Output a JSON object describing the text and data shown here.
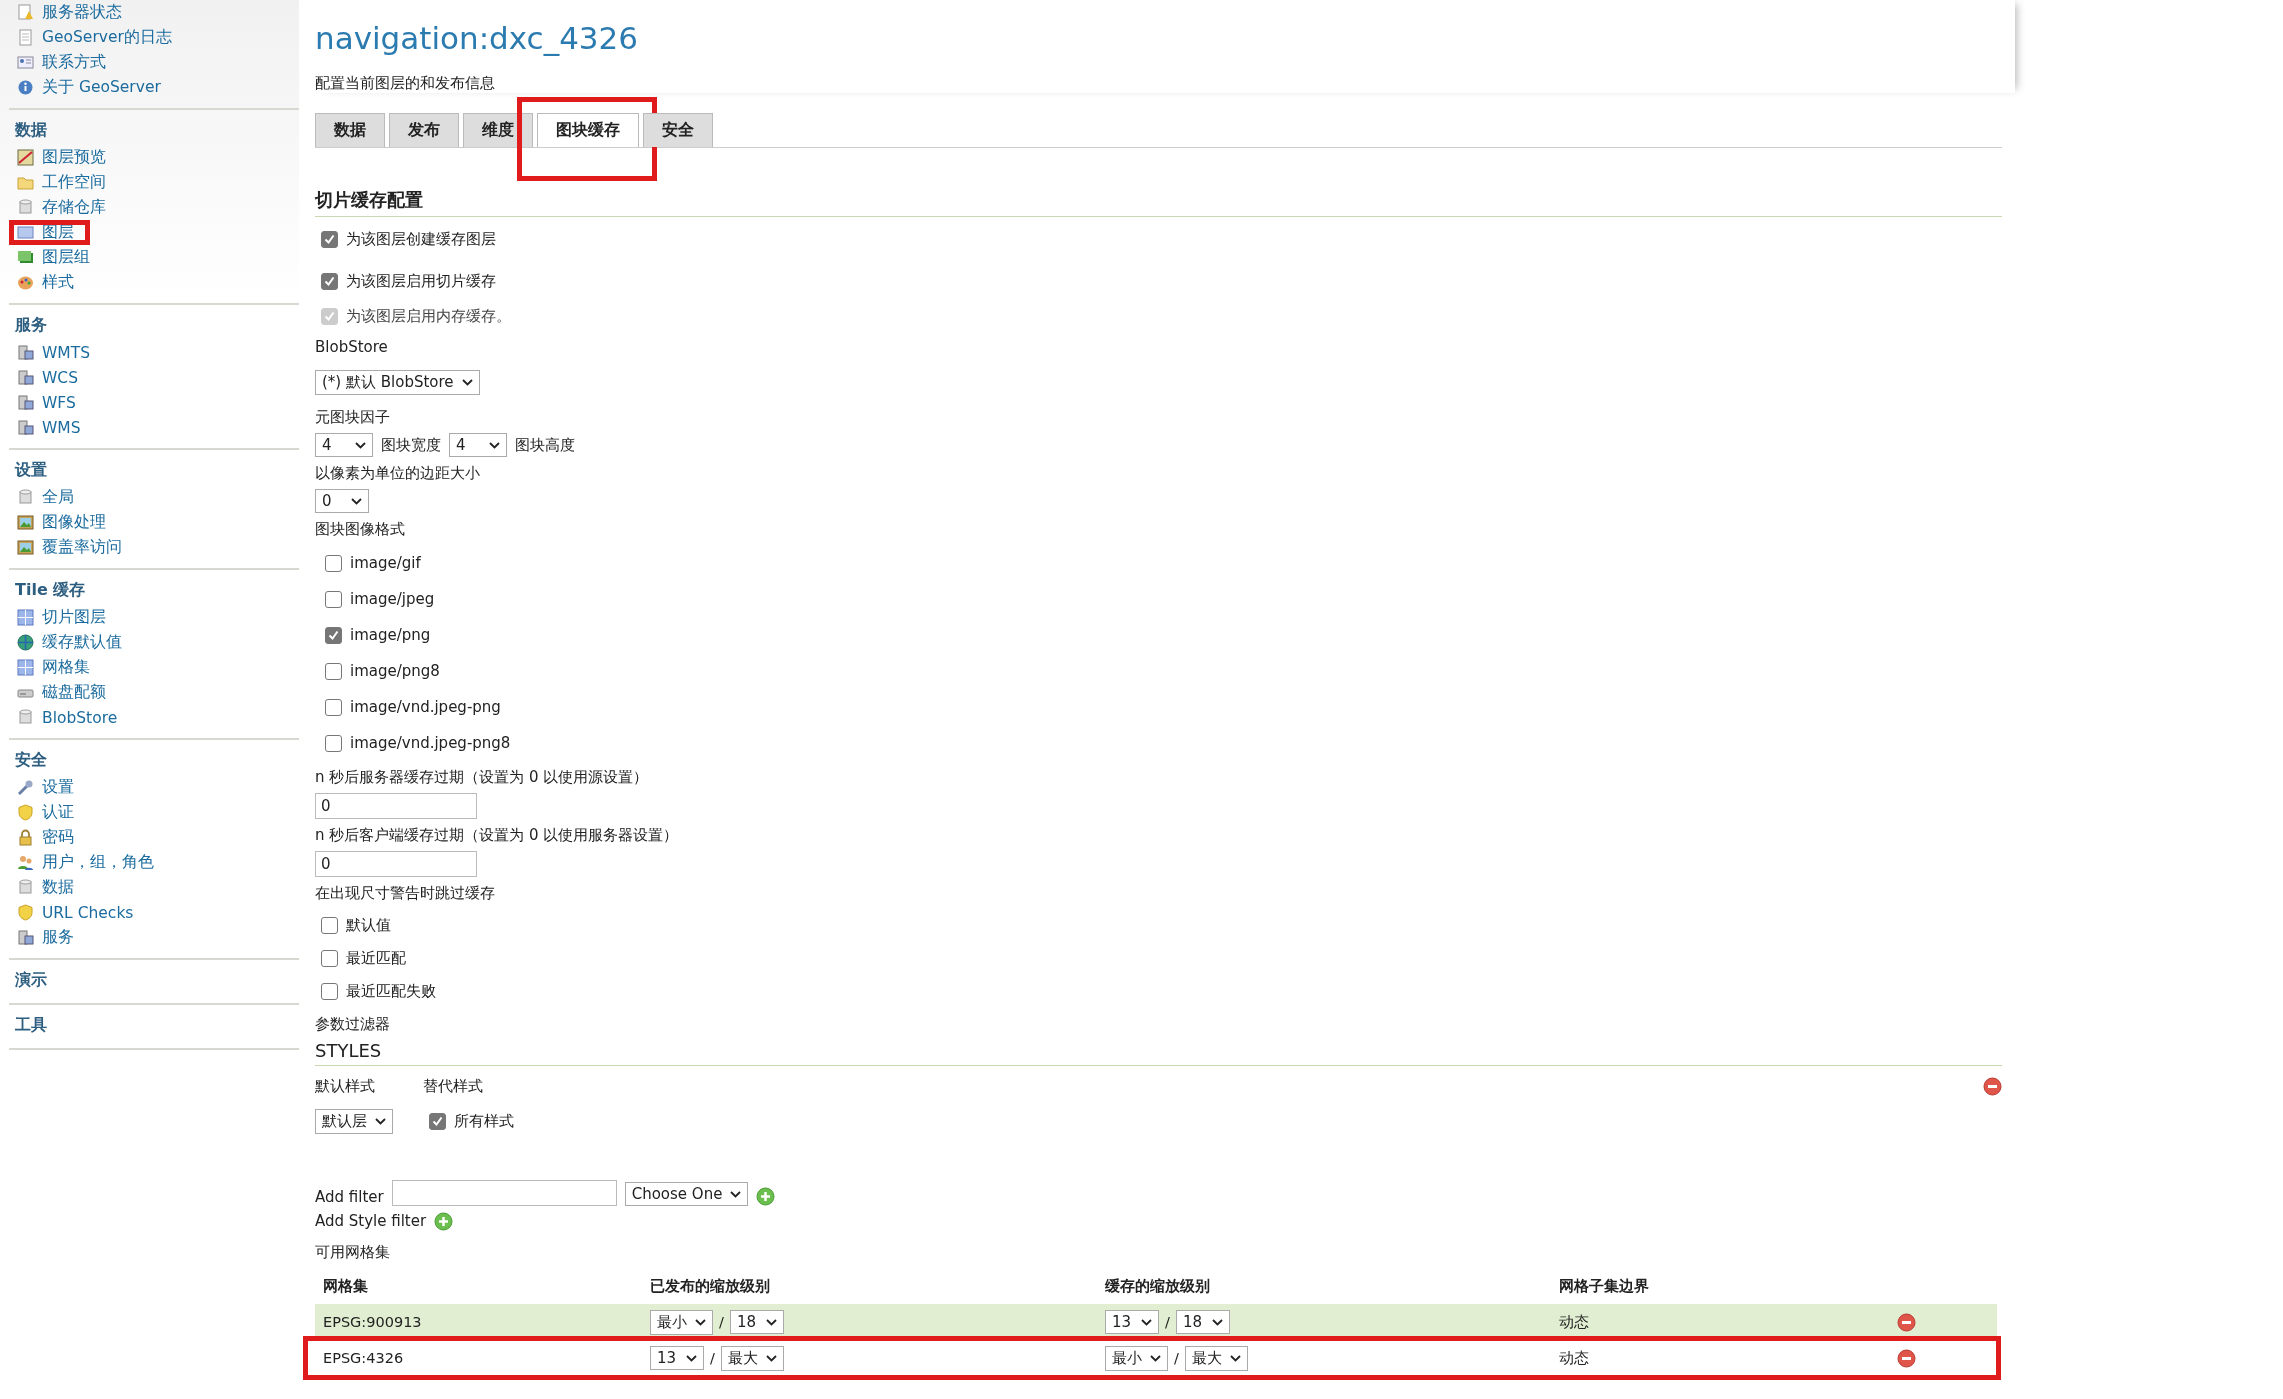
{
  "sidebar": {
    "sections": [
      {
        "items": [
          {
            "label": "服务器状态",
            "kind": "status",
            "highlighted": false
          },
          {
            "label": "GeoServer的日志",
            "kind": "doc",
            "highlighted": false
          },
          {
            "label": "联系方式",
            "kind": "card",
            "highlighted": false
          },
          {
            "label": "关于 GeoServer",
            "kind": "info",
            "highlighted": false
          }
        ]
      },
      {
        "title": "数据",
        "items": [
          {
            "label": "图层预览",
            "kind": "map",
            "highlighted": false
          },
          {
            "label": "工作空间",
            "kind": "folder",
            "highlighted": false
          },
          {
            "label": "存储仓库",
            "kind": "cylinder",
            "highlighted": false
          },
          {
            "label": "图层",
            "kind": "layer",
            "highlighted": true
          },
          {
            "label": "图层组",
            "kind": "layers",
            "highlighted": false
          },
          {
            "label": "样式",
            "kind": "palette",
            "highlighted": false
          }
        ]
      },
      {
        "title": "服务",
        "items": [
          {
            "label": "WMTS",
            "kind": "server",
            "highlighted": false
          },
          {
            "label": "WCS",
            "kind": "server",
            "highlighted": false
          },
          {
            "label": "WFS",
            "kind": "server",
            "highlighted": false
          },
          {
            "label": "WMS",
            "kind": "server",
            "highlighted": false
          }
        ]
      },
      {
        "title": "设置",
        "items": [
          {
            "label": "全局",
            "kind": "cylinder",
            "highlighted": false
          },
          {
            "label": "图像处理",
            "kind": "image",
            "highlighted": false
          },
          {
            "label": "覆盖率访问",
            "kind": "image",
            "highlighted": false
          }
        ]
      },
      {
        "title": "Tile 缓存",
        "items": [
          {
            "label": "切片图层",
            "kind": "grid",
            "highlighted": false
          },
          {
            "label": "缓存默认值",
            "kind": "globe",
            "highlighted": false
          },
          {
            "label": "网格集",
            "kind": "grid",
            "highlighted": false
          },
          {
            "label": "磁盘配额",
            "kind": "disk",
            "highlighted": false
          },
          {
            "label": "BlobStore",
            "kind": "cylinder",
            "highlighted": false
          }
        ]
      },
      {
        "title": "安全",
        "items": [
          {
            "label": "设置",
            "kind": "wrench",
            "highlighted": false
          },
          {
            "label": "认证",
            "kind": "shield",
            "highlighted": false
          },
          {
            "label": "密码",
            "kind": "lock",
            "highlighted": false
          },
          {
            "label": "用户，组，角色",
            "kind": "users",
            "highlighted": false
          },
          {
            "label": "数据",
            "kind": "cylinder",
            "highlighted": false
          },
          {
            "label": "URL Checks",
            "kind": "shield",
            "highlighted": false
          },
          {
            "label": "服务",
            "kind": "server",
            "highlighted": false
          }
        ]
      },
      {
        "title": "演示"
      },
      {
        "title": "工具"
      }
    ]
  },
  "page": {
    "title": "navigation:dxc_4326",
    "description": "配置当前图层的和发布信息"
  },
  "tabs": [
    {
      "label": "数据",
      "selected": false,
      "highlighted": false
    },
    {
      "label": "发布",
      "selected": false,
      "highlighted": false
    },
    {
      "label": "维度",
      "selected": false,
      "highlighted": false
    },
    {
      "label": "图块缓存",
      "selected": true,
      "highlighted": true
    },
    {
      "label": "安全",
      "selected": false,
      "highlighted": false
    }
  ],
  "tile_cache": {
    "heading": "切片缓存配置",
    "options": [
      {
        "label": "为该图层创建缓存图层",
        "checked": true,
        "disabled": false
      },
      {
        "label": "为该图层启用切片缓存",
        "checked": true,
        "disabled": false
      },
      {
        "label": "为该图层启用内存缓存。",
        "checked": true,
        "disabled": true
      }
    ],
    "blobstore": {
      "label": "BlobStore",
      "value": "(*) 默认 BlobStore"
    },
    "metatiling": {
      "label": "元图块因子",
      "width_value": "4",
      "width_label": "图块宽度",
      "height_value": "4",
      "height_label": "图块高度"
    },
    "gutter": {
      "label": "以像素为单位的边距大小",
      "value": "0"
    },
    "formats": {
      "label": "图块图像格式",
      "options": [
        {
          "label": "image/gif",
          "checked": false
        },
        {
          "label": "image/jpeg",
          "checked": false
        },
        {
          "label": "image/png",
          "checked": true
        },
        {
          "label": "image/png8",
          "checked": false
        },
        {
          "label": "image/vnd.jpeg-png",
          "checked": false
        },
        {
          "label": "image/vnd.jpeg-png8",
          "checked": false
        }
      ]
    },
    "server_expire": {
      "label": "n 秒后服务器缓存过期（设置为 0 以使用源设置）",
      "value": "0"
    },
    "client_expire": {
      "label": "n 秒后客户端缓存过期（设置为 0 以使用服务器设置）",
      "value": "0"
    },
    "skip_warnings": {
      "label": "在出现尺寸警告时跳过缓存",
      "options": [
        {
          "label": "默认值",
          "checked": false
        },
        {
          "label": "最近匹配",
          "checked": false
        },
        {
          "label": "最近匹配失败",
          "checked": false
        }
      ]
    },
    "parameter_filters": "参数过滤器"
  },
  "styles": {
    "heading": "STYLES",
    "default_label": "默认样式",
    "alternate_label": "替代样式",
    "default_value": "默认层",
    "all_styles": {
      "label": "所有样式",
      "checked": true
    }
  },
  "add_filter": {
    "label": "Add filter",
    "select": "Choose One"
  },
  "add_style_filter": {
    "label": "Add Style filter"
  },
  "gridsets": {
    "label": "可用网格集",
    "columns": [
      "网格集",
      "已发布的缩放级别",
      "缓存的缩放级别",
      "网格子集边界"
    ],
    "rows": [
      {
        "name": "EPSG:900913",
        "published_min": "最小",
        "published_sep": "/",
        "published_max": "18",
        "cached_min": "13",
        "cached_sep": "/",
        "cached_max": "18",
        "bounds": "动态",
        "highlighted": false
      },
      {
        "name": "EPSG:4326",
        "published_min": "13",
        "published_sep": "/",
        "published_max": "最大",
        "cached_min": "最小",
        "cached_sep": "/",
        "cached_max": "最大",
        "bounds": "动态",
        "highlighted": true
      }
    ]
  }
}
